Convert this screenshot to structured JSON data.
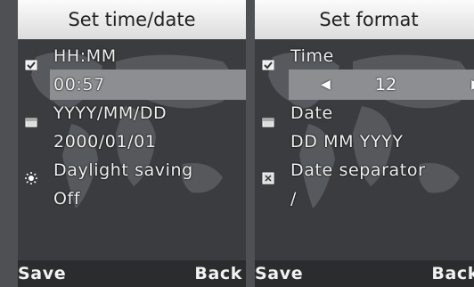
{
  "left_panel": {
    "title": "Set time/date",
    "rows": [
      {
        "label": "HH:MM",
        "icon": "clock-checkbox-icon"
      },
      {
        "value": "00:57"
      },
      {
        "label": "YYYY/MM/DD",
        "icon": "calendar-icon"
      },
      {
        "value": "2000/01/01"
      },
      {
        "label": "Daylight saving",
        "icon": "sun-icon"
      },
      {
        "value": "Off"
      }
    ],
    "softkeys": {
      "left": "Save",
      "right": "Back"
    }
  },
  "right_panel": {
    "title": "Set format",
    "rows": [
      {
        "label": "Time",
        "icon": "clock-checkbox-icon"
      },
      {
        "value": "12",
        "arrows": [
          "◀",
          "▶"
        ]
      },
      {
        "label": "Date",
        "icon": "calendar-icon"
      },
      {
        "value": "DD MM YYYY"
      },
      {
        "label": "Date separator",
        "icon": "separator-box-icon"
      },
      {
        "value": "/"
      }
    ],
    "softkeys": {
      "left": "Save",
      "right": "Back"
    }
  },
  "colors": {
    "title_bg": "#e9e9e9",
    "highlight": "#8c8e91",
    "text": "#f0f0f0",
    "softkey_bar": "#2b2c2e"
  }
}
